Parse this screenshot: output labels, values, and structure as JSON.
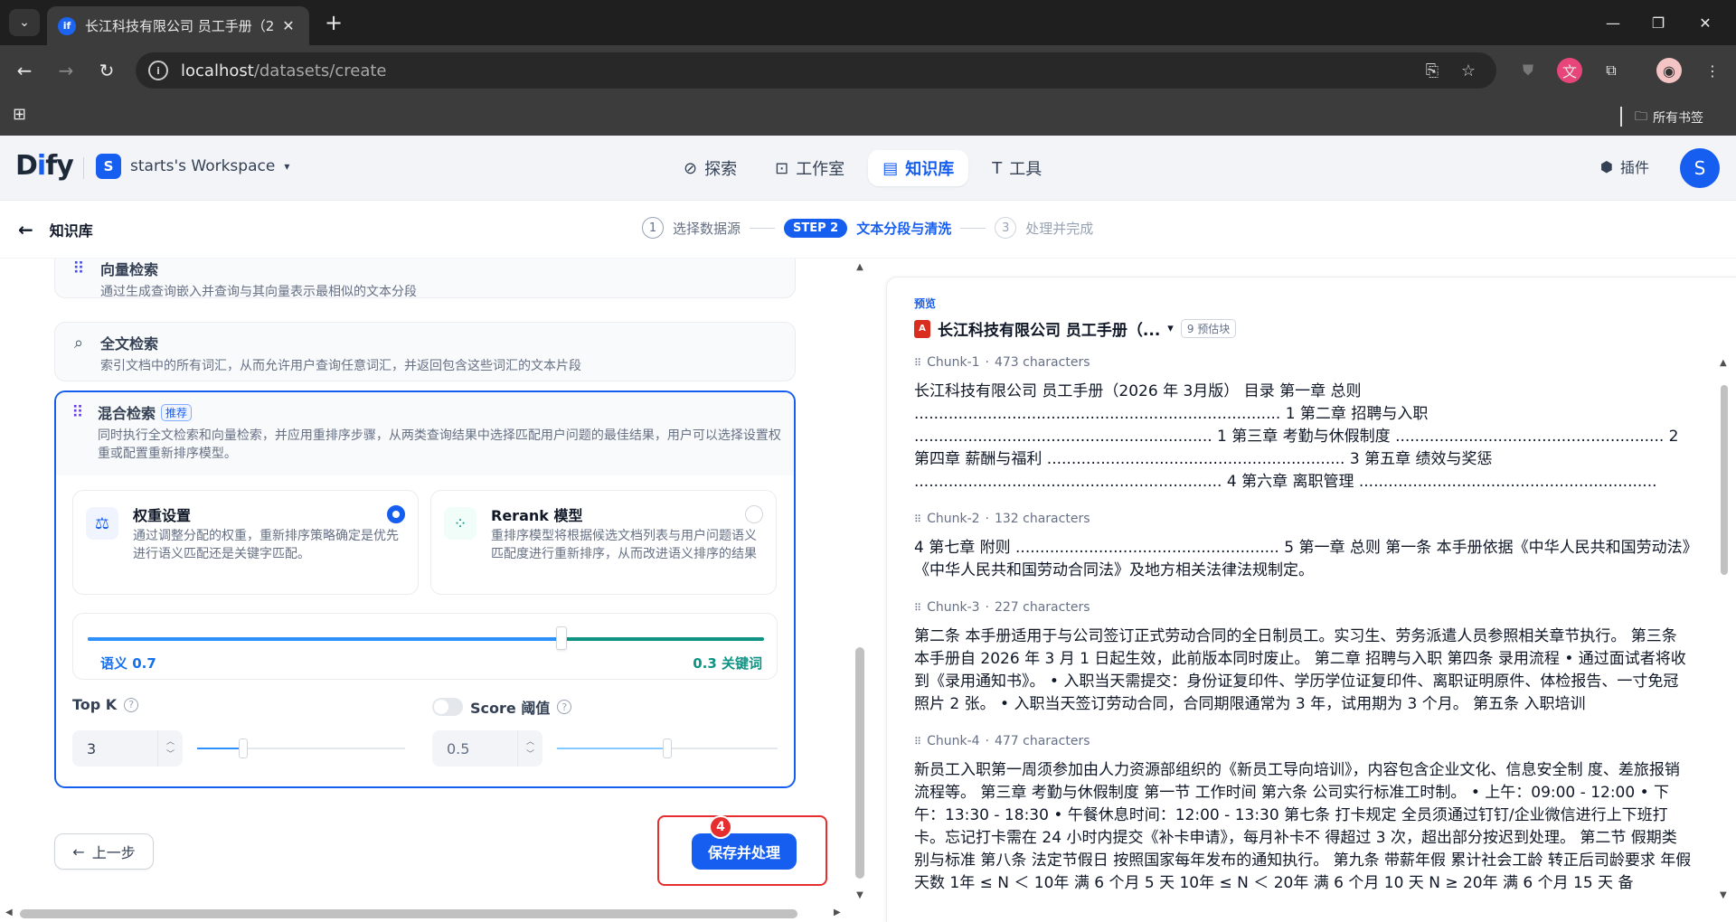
{
  "browser": {
    "tab_title": "长江科技有限公司 员工手册（2",
    "tab_favicon": "if",
    "url_host": "localhost",
    "url_path": "/datasets/create",
    "bookmarks_all": "所有书签"
  },
  "header": {
    "logo_prefix": "D",
    "logo_i": "i",
    "logo_suffix": "fy",
    "workspace_initial": "S",
    "workspace_name": "starts's Workspace",
    "nav": [
      {
        "label": "探索",
        "icon": "compass-icon"
      },
      {
        "label": "工作室",
        "icon": "robot-icon"
      },
      {
        "label": "知识库",
        "icon": "book-icon",
        "active": true
      },
      {
        "label": "工具",
        "icon": "hammer-icon"
      }
    ],
    "plugin_label": "插件",
    "user_initial": "S"
  },
  "steps": {
    "back_label": "知识库",
    "step1_num": "1",
    "step1_label": "选择数据源",
    "step2_badge": "STEP 2",
    "step2_label": "文本分段与清洗",
    "step3_num": "3",
    "step3_label": "处理并完成"
  },
  "retrieval": {
    "vector": {
      "title": "向量检索",
      "desc": "通过生成查询嵌入并查询与其向量表示最相似的文本分段"
    },
    "fulltext": {
      "title": "全文检索",
      "desc": "索引文档中的所有词汇，从而允许用户查询任意词汇，并返回包含这些词汇的文本片段"
    },
    "hybrid": {
      "title": "混合检索",
      "badge": "推荐",
      "desc": "同时执行全文检索和向量检索，并应用重排序步骤，从两类查询结果中选择匹配用户问题的最佳结果，用户可以选择设置权重或配置重新排序模型。",
      "weight_card": {
        "title": "权重设置",
        "desc": "通过调整分配的权重，重新排序策略确定是优先进行语义匹配还是关键字匹配。",
        "selected": true
      },
      "rerank_card": {
        "title": "Rerank 模型",
        "desc": "重排序模型将根据候选文档列表与用户问题语义匹配度进行重新排序，从而改进语义排序的结果",
        "selected": false
      },
      "semantic_weight": 0.7,
      "semantic_label": "语义 0.7",
      "keyword_label": "0.3 关键词",
      "top_k_label": "Top K",
      "top_k_value": "3",
      "top_k_fraction": 0.22,
      "score_label": "Score 阈值",
      "score_value": "0.5",
      "score_fraction": 0.5
    }
  },
  "actions": {
    "prev_label": "上一步",
    "save_label": "保存并处理",
    "step_marker": "4"
  },
  "preview": {
    "label": "预览",
    "doc_name": "长江科技有限公司 员工手册（...",
    "chunk_count": "9 预估块",
    "chunks": [
      {
        "name": "Chunk-1",
        "chars": "473 characters",
        "text": "长江科技有限公司 员工手册（2026 年 3月版） 目录 第一章 总则 ........................................................................... 1 第二章 招聘与入职 ............................................................. 1 第三章 考勤与休假制度 ....................................................... 2 第四章 薪酬与福利 ............................................................. 3 第五章 绩效与奖惩 ............................................................... 4 第六章 离职管理 ............................................................."
      },
      {
        "name": "Chunk-2",
        "chars": "132 characters",
        "text": "4 第七章 附则 ...................................................... 5 第一章 总则 第一条 本手册依据《中华人民共和国劳动法》《中华人民共和国劳动合同法》及地方相关法律法规制定。"
      },
      {
        "name": "Chunk-3",
        "chars": "227 characters",
        "text": "第二条 本手册适用于与公司签订正式劳动合同的全日制员工。实习生、劳务派遣人员参照相关章节执行。 第三条 本手册自 2026 年 3 月 1 日起生效，此前版本同时废止。 第二章 招聘与入职 第四条 录用流程 • 通过面试者将收到《录用通知书》。 • 入职当天需提交：身份证复印件、学历学位证复印件、离职证明原件、体检报告、一寸免冠照片 2 张。 • 入职当天签订劳动合同，合同期限通常为 3 年，试用期为 3 个月。 第五条 入职培训"
      },
      {
        "name": "Chunk-4",
        "chars": "477 characters",
        "text": "新员工入职第一周须参加由人力资源部组织的《新员工导向培训》，内容包含企业文化、信息安全制 度、差旅报销流程等。 第三章 考勤与休假制度 第一节 工作时间 第六条 公司实行标准工时制。 • 上午：09:00 - 12:00 • 下午：13:30 - 18:30 • 午餐休息时间：12:00 - 13:30 第七条 打卡规定 全员须通过钉钉/企业微信进行上下班打卡。忘记打卡需在 24 小时内提交《补卡申请》，每月补卡不 得超过 3 次，超出部分按迟到处理。 第二节 假期类别与标准 第八条 法定节假日 按照国家每年发布的通知执行。 第九条 带薪年假 累计社会工龄 转正后司龄要求 年假天数 1年 ≤ N ＜ 10年 满 6 个月 5 天 10年 ≤ N ＜ 20年 满 6 个月 10 天 N ≥ 20年 满 6 个月 15 天 备"
      }
    ]
  },
  "colors": {
    "accent": "#155eef",
    "semantic": "#2e90fa",
    "keyword": "#0e9384",
    "highlight": "#e62e2e"
  }
}
